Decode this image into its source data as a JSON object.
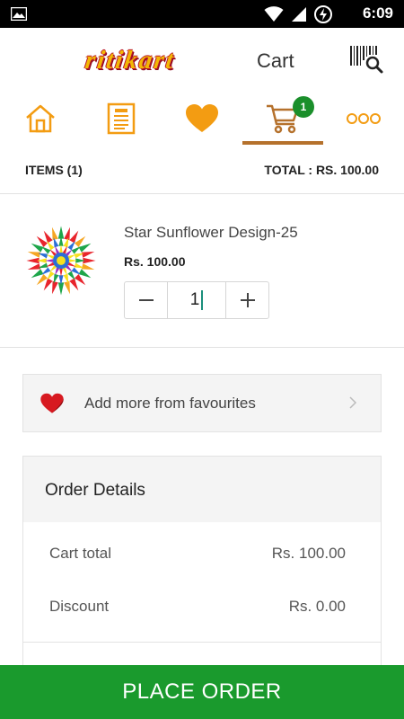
{
  "status_bar": {
    "time": "6:09"
  },
  "app_bar": {
    "logo": "ritikart",
    "title": "Cart"
  },
  "nav": {
    "items": [
      {
        "icon": "home-icon"
      },
      {
        "icon": "menu-list-icon"
      },
      {
        "icon": "heart-icon"
      },
      {
        "icon": "cart-icon",
        "badge": "1",
        "active": true
      },
      {
        "icon": "more-icon"
      }
    ]
  },
  "summary": {
    "items_label": "ITEMS (1)",
    "total_label": "TOTAL : RS. 100.00"
  },
  "cart_item": {
    "name": "Star Sunflower Design-25",
    "price": "Rs. 100.00",
    "quantity": "1"
  },
  "favourites": {
    "label": "Add more from favourites"
  },
  "order_details": {
    "title": "Order Details",
    "rows": [
      {
        "label": "Cart total",
        "value": "Rs. 100.00"
      },
      {
        "label": "Discount",
        "value": "Rs. 0.00"
      }
    ]
  },
  "place_order": {
    "label": "PLACE ORDER"
  },
  "colors": {
    "accent": "#f39c12",
    "nav_active": "#b5712c",
    "badge": "#1b8f2b",
    "primary_button": "#1a9a2d",
    "logo_fill": "#f2b705",
    "logo_outline": "#b8112a"
  }
}
